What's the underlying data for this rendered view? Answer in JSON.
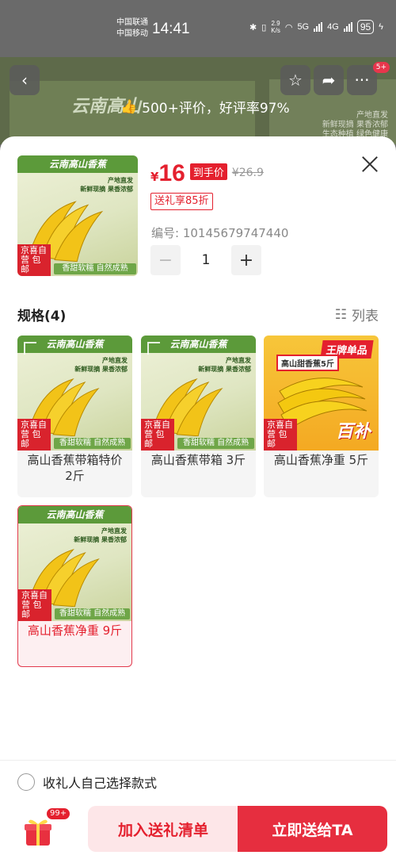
{
  "status_bar": {
    "carrier1": "中国联通",
    "carrier2": "中国移动",
    "time": "14:41",
    "net_speed": "2.9",
    "net_unit": "K/s",
    "net_5g": "5G",
    "net_4g": "4G",
    "battery": "95"
  },
  "background_page": {
    "banner_title": "云南高山",
    "rating_text": "500+评价，好评率97%",
    "badge": "5+",
    "side_text_1": "产地直发",
    "side_text_2": "新鲜现摘 果香浓郁",
    "side_text_3": "生态种植 绿色健康"
  },
  "product": {
    "thumb_title": "云南高山香蕉",
    "thumb_sub": "产地直发\n新鲜现摘 果香浓郁",
    "thumb_tag": "京喜自营 包邮",
    "thumb_tag2": "香甜软糯 自然成熟",
    "currency": "¥",
    "price": "16",
    "price_tag": "到手价",
    "original_price": "¥26.9",
    "promo": "送礼享85折",
    "sku_number": "编号: 10145679747440",
    "quantity": "1",
    "minus": "−",
    "plus": "+"
  },
  "spec": {
    "title": "规格(4)",
    "list_toggle": "列表",
    "options": [
      {
        "label": "高山香蕉带箱特价 2斤",
        "selected": false
      },
      {
        "label": "高山香蕉带箱 3斤",
        "selected": false
      },
      {
        "label": "高山香蕉净重 5斤",
        "selected": false
      },
      {
        "label": "高山香蕉净重 9斤",
        "selected": true
      }
    ],
    "hot_king": "王牌单品",
    "hot_sweet": "高山甜香蕉5斤",
    "hot_subsidy": "百补"
  },
  "recipient_option": "收礼人自己选择款式",
  "bottom": {
    "gift_badge": "99+",
    "add_to_list": "加入送礼清单",
    "send_now": "立即送给TA"
  },
  "colors": {
    "accent": "#e4202e",
    "accent_light": "#fde6e8",
    "send_button": "#e62e3f"
  }
}
